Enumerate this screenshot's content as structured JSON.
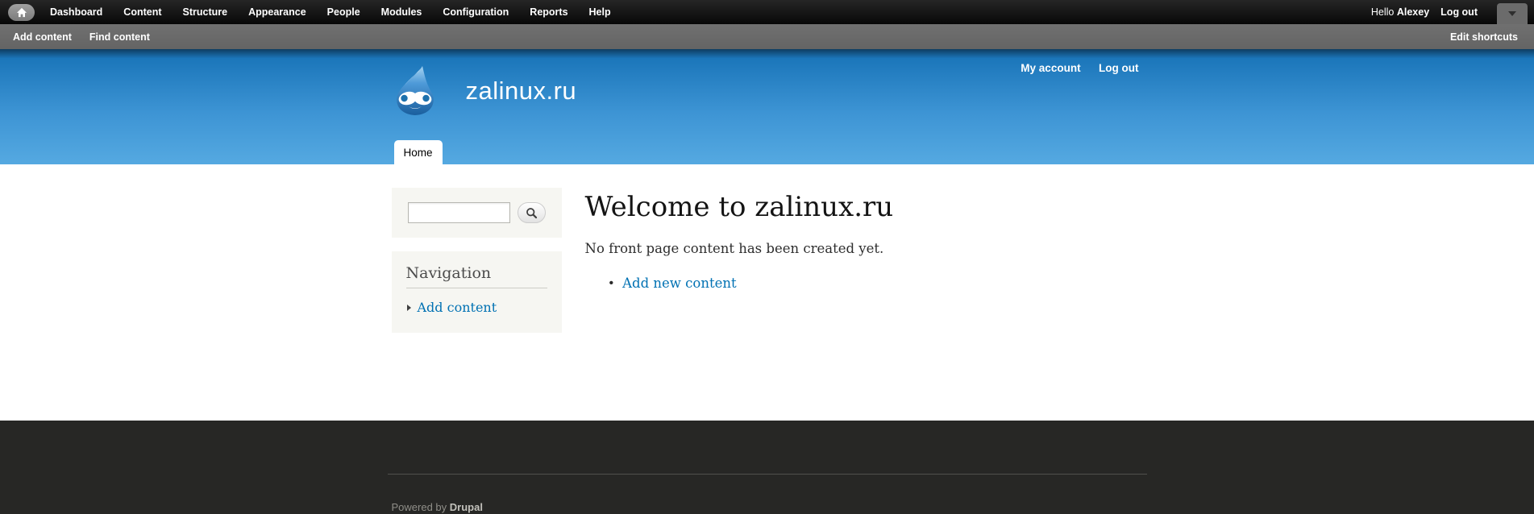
{
  "toolbar": {
    "menu": [
      "Dashboard",
      "Content",
      "Structure",
      "Appearance",
      "People",
      "Modules",
      "Configuration",
      "Reports",
      "Help"
    ],
    "greeting_prefix": "Hello ",
    "username": "Alexey",
    "logout_label": "Log out"
  },
  "shortcuts": {
    "items": [
      "Add content",
      "Find content"
    ],
    "edit_label": "Edit shortcuts"
  },
  "header": {
    "site_name": "zalinux.ru",
    "my_account_label": "My account",
    "logout_label": "Log out",
    "active_tab": "Home"
  },
  "sidebar": {
    "search": {
      "value": ""
    },
    "navigation": {
      "title": "Navigation",
      "items": [
        {
          "label": "Add content"
        }
      ]
    }
  },
  "main": {
    "title": "Welcome to zalinux.ru",
    "empty_text": "No front page content has been created yet.",
    "links": [
      {
        "label": "Add new content"
      }
    ]
  },
  "footer": {
    "powered_prefix": "Powered by ",
    "powered_link": "Drupal"
  },
  "colors": {
    "link_blue": "#0071b3",
    "header_gradient_top": "#1b76ba",
    "header_gradient_bottom": "#55a9e1",
    "admin_bar_black": "#0c0c0c",
    "shortcut_bar_gray": "#6b6b6b",
    "block_background": "#f6f6f2",
    "footer_background": "#272725"
  }
}
